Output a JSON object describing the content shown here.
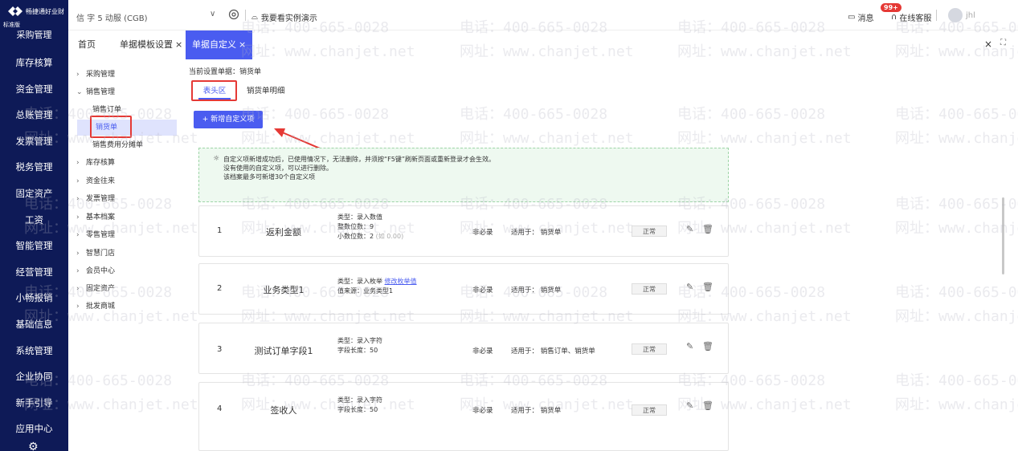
{
  "brand": {
    "name": "畅捷通好业财",
    "edition": "标准版"
  },
  "left_nav": [
    "采购管理",
    "库存核算",
    "资金管理",
    "总账管理",
    "发票管理",
    "税务管理",
    "固定资产",
    "工资",
    "智能管理",
    "经营管理",
    "小畅报销",
    "基础信息",
    "系统管理",
    "企业协同",
    "新手引导",
    "应用中心"
  ],
  "topbar": {
    "org": "信 字 5 动服 (CGB)",
    "demo_label": "我要看实例演示",
    "messages_label": "消息",
    "messages_badge": "99+",
    "service_label": "在线客服",
    "username": "jhl"
  },
  "tabs": [
    {
      "label": "首页"
    },
    {
      "label": "单据模板设置"
    },
    {
      "label": "单据自定义"
    }
  ],
  "tree": {
    "groups": [
      "采购管理",
      "销售管理",
      "库存核算",
      "资金往来",
      "发票管理",
      "基本档案",
      "零售管理",
      "智慧门店",
      "会员中心",
      "固定资产",
      "批发商城"
    ],
    "sales_children": [
      "销售订单",
      "销货单",
      "销售费用分摊单"
    ]
  },
  "main": {
    "current_doc": "当前设置单据：销货单",
    "subtabs": [
      "表头区",
      "销货单明细"
    ],
    "add_button": "+ 新增自定义项",
    "notice": [
      "自定义项新增成功后，已使用情况下，无法删除，并须按“F5键”刷新页面或重新登录才会生效。",
      "没有使用的自定义项，可以进行删除。",
      "该档案最多可新增30个自定义项"
    ],
    "items": [
      {
        "index": "1",
        "name": "返利金额",
        "type_lines": [
          "类型：录入数值",
          "整数位数：9",
          "小数位数：2"
        ],
        "type_note": "(如 0.00)",
        "required": "非必录",
        "apply": "适用于：  销货单",
        "status": "正常"
      },
      {
        "index": "2",
        "name": "业务类型1",
        "type_lines": [
          "类型：录入枚举",
          "值来源：业务类型1"
        ],
        "link": "修改枚举值",
        "required": "非必录",
        "apply": "适用于：  销货单",
        "status": "正常"
      },
      {
        "index": "3",
        "name": "测试订单字段1",
        "type_lines": [
          "类型：录入字符",
          "字段长度：50"
        ],
        "required": "非必录",
        "apply": "适用于：  销售订单、销货单",
        "status": "正常"
      },
      {
        "index": "4",
        "name": "签收人",
        "type_lines": [
          "类型：录入字符",
          "字段长度：50"
        ],
        "required": "非必录",
        "apply": "适用于：  销货单",
        "status": "正常"
      }
    ]
  },
  "watermark": {
    "phone": "电话：400-665-0028",
    "site": "网址：www.chanjet.net"
  },
  "colors": {
    "nav_bg": "#0e1a57",
    "accent": "#4a5cf0",
    "highlight": "#e53935",
    "notice_bg": "#eef9f0"
  }
}
